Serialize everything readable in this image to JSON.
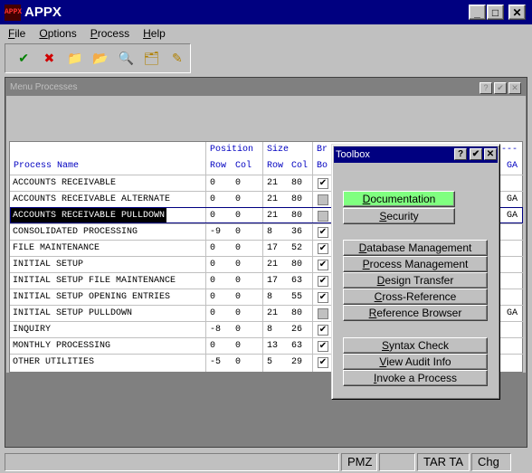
{
  "window": {
    "title": "APPX",
    "icon_text": "APPX",
    "min": "_",
    "max": "□",
    "close": "✕"
  },
  "menu": [
    {
      "pre": "",
      "u": "F",
      "post": "ile"
    },
    {
      "pre": "",
      "u": "O",
      "post": "ptions"
    },
    {
      "pre": "",
      "u": "P",
      "post": "rocess"
    },
    {
      "pre": "",
      "u": "H",
      "post": "elp"
    }
  ],
  "toolbar": [
    {
      "name": "ok-tool-icon",
      "glyph": "✔"
    },
    {
      "name": "cancel-tool-icon",
      "glyph": "✖"
    },
    {
      "name": "new-folder-icon",
      "glyph": "📁"
    },
    {
      "name": "open-folder-icon",
      "glyph": "📂"
    },
    {
      "name": "search-folder-icon",
      "glyph": "🔍"
    },
    {
      "name": "delete-folder-icon",
      "glyph": "🗂"
    },
    {
      "name": "edit-folder-icon",
      "glyph": "✎"
    }
  ],
  "child_window": {
    "title": "Menu Processes",
    "help": "?",
    "ok": "✔",
    "close": "✕"
  },
  "grid": {
    "headers": {
      "process_name": "Process Name",
      "position": "Position",
      "row": "Row",
      "col": "Col",
      "size": "Size",
      "size_row": "Row",
      "size_col": "Col",
      "br": "Br",
      "bo": "Bo",
      "dashes": "---",
      "ga": "GA"
    },
    "rows": [
      {
        "name": "ACCOUNTS RECEIVABLE",
        "prow": "0",
        "pcol": "0",
        "srow": "21",
        "scol": "80",
        "border": true,
        "ga": ""
      },
      {
        "name": "ACCOUNTS RECEIVABLE ALTERNATE",
        "prow": "0",
        "pcol": "0",
        "srow": "21",
        "scol": "80",
        "border": false,
        "ga": "GA"
      },
      {
        "name": "ACCOUNTS RECEIVABLE PULLDOWN",
        "prow": "0",
        "pcol": "0",
        "srow": "21",
        "scol": "80",
        "border": false,
        "ga": "GA"
      },
      {
        "name": "CONSOLIDATED PROCESSING",
        "prow": "-9",
        "pcol": "0",
        "srow": "8",
        "scol": "36",
        "border": true,
        "ga": ""
      },
      {
        "name": "FILE MAINTENANCE",
        "prow": "0",
        "pcol": "0",
        "srow": "17",
        "scol": "52",
        "border": true,
        "ga": ""
      },
      {
        "name": "INITIAL SETUP",
        "prow": "0",
        "pcol": "0",
        "srow": "21",
        "scol": "80",
        "border": true,
        "ga": ""
      },
      {
        "name": "INITIAL SETUP FILE MAINTENANCE",
        "prow": "0",
        "pcol": "0",
        "srow": "17",
        "scol": "63",
        "border": true,
        "ga": ""
      },
      {
        "name": "INITIAL SETUP OPENING ENTRIES",
        "prow": "0",
        "pcol": "0",
        "srow": "8",
        "scol": "55",
        "border": true,
        "ga": ""
      },
      {
        "name": "INITIAL SETUP PULLDOWN",
        "prow": "0",
        "pcol": "0",
        "srow": "21",
        "scol": "80",
        "border": false,
        "ga": "GA"
      },
      {
        "name": "INQUIRY",
        "prow": "-8",
        "pcol": "0",
        "srow": "8",
        "scol": "26",
        "border": true,
        "ga": ""
      },
      {
        "name": "MONTHLY PROCESSING",
        "prow": "0",
        "pcol": "0",
        "srow": "13",
        "scol": "63",
        "border": true,
        "ga": ""
      },
      {
        "name": "OTHER UTILITIES",
        "prow": "-5",
        "pcol": "0",
        "srow": "5",
        "scol": "29",
        "border": true,
        "ga": ""
      }
    ]
  },
  "toolbox": {
    "title": "Toolbox",
    "help": "?",
    "ok": "✔",
    "close": "✕",
    "buttons": [
      {
        "id": "documentation",
        "label": "Documentation",
        "u": "D",
        "active": true
      },
      {
        "id": "security",
        "label": "Security",
        "u": "S"
      },
      {
        "id": "database-management",
        "label": "Database Management",
        "u": "D"
      },
      {
        "id": "process-management",
        "label": "Process Management",
        "u": "P"
      },
      {
        "id": "design-transfer",
        "label": "Design Transfer",
        "u": "D"
      },
      {
        "id": "cross-reference",
        "label": "Cross-Reference",
        "u": "C"
      },
      {
        "id": "reference-browser",
        "label": "Reference Browser",
        "u": "R"
      },
      {
        "id": "syntax-check",
        "label": "Syntax Check",
        "u": "S"
      },
      {
        "id": "view-audit-info",
        "label": "View Audit Info",
        "u": "V"
      },
      {
        "id": "invoke-a-process",
        "label": "Invoke a Process",
        "u": "I"
      }
    ]
  },
  "status": [
    "PMZ",
    "TAR TA",
    "Chg"
  ],
  "colors": {
    "title_bg": "#000080",
    "header_text": "#0000c0",
    "active_button": "#80ff80"
  }
}
